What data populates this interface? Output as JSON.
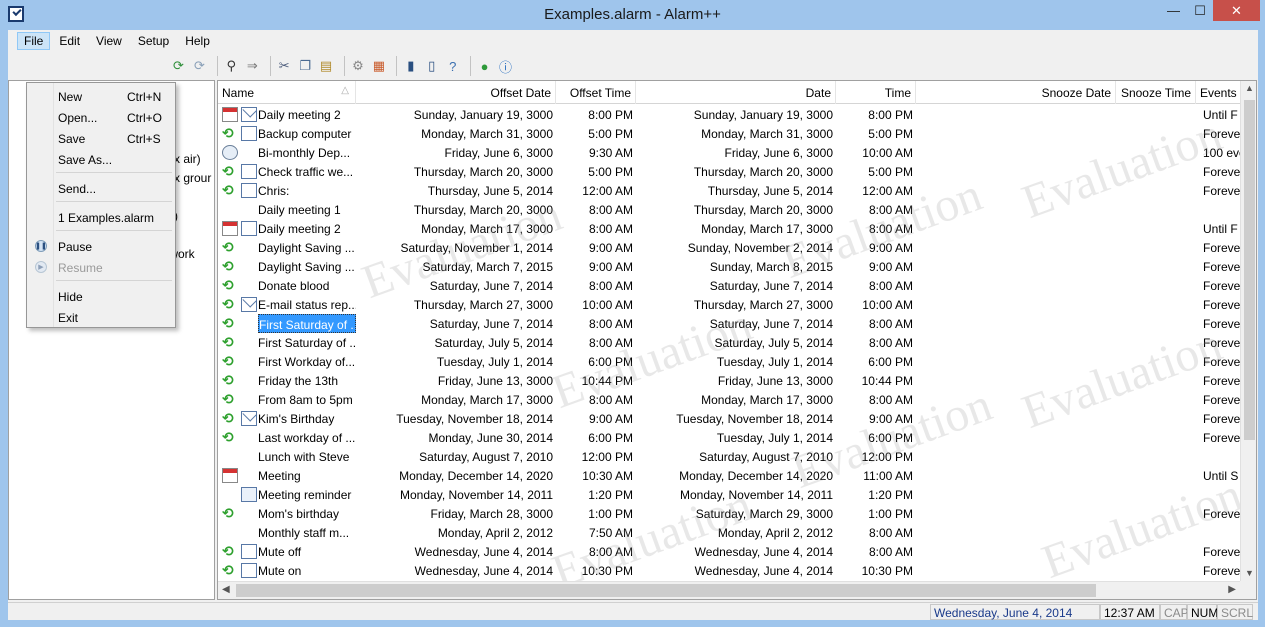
{
  "window": {
    "title": "Examples.alarm - Alarm++",
    "minimize": "—",
    "maximize": "☐",
    "close": "✕"
  },
  "menubar": [
    "File",
    "Edit",
    "View",
    "Setup",
    "Help"
  ],
  "toolbar_icons": [
    "open-folder-icon",
    "refresh-icon",
    "binoculars-icon",
    "arrow-icon",
    "cut-icon",
    "copy-icon",
    "paste-icon",
    "gear-icon",
    "calendar-icon",
    "book-icon",
    "open-book-icon",
    "help-icon",
    "globe-icon",
    "info-icon"
  ],
  "file_menu": {
    "items": [
      {
        "label": "New",
        "shortcut": "Ctrl+N"
      },
      {
        "label": "Open...",
        "shortcut": "Ctrl+O"
      },
      {
        "label": "Save",
        "shortcut": "Ctrl+S"
      },
      {
        "label": "Save As...",
        "shortcut": ""
      },
      {
        "label": "Send...",
        "shortcut": ""
      },
      {
        "label": "1 Examples.alarm",
        "shortcut": ""
      },
      {
        "label": "Pause",
        "shortcut": ""
      },
      {
        "label": "Resume",
        "shortcut": ""
      },
      {
        "label": "Hide",
        "shortcut": ""
      },
      {
        "label": "Exit",
        "shortcut": ""
      }
    ]
  },
  "tree_fragments": [
    "Ex air)",
    "Ex grour",
    ")",
    "S)",
    "twork"
  ],
  "columns": [
    "Name",
    "Offset Date",
    "Offset Time",
    "Date",
    "Time",
    "Snooze Date",
    "Snooze Time",
    "Events"
  ],
  "rows": [
    {
      "icon": "calendar",
      "icon2": "mail",
      "name": "Daily meeting 2",
      "odate": "Sunday, January 19, 3000",
      "otime": "8:00 PM",
      "date": "Sunday, January 19, 3000",
      "time": "8:00 PM",
      "events": "Until F"
    },
    {
      "icon": "recur",
      "icon2": "box",
      "name": "Backup computer",
      "odate": "Monday, March 31, 3000",
      "otime": "5:00 PM",
      "date": "Monday, March 31, 3000",
      "time": "5:00 PM",
      "events": "Foreve"
    },
    {
      "icon": "clock",
      "icon2": "",
      "name": "Bi-monthly Dep...",
      "odate": "Friday, June 6, 3000",
      "otime": "9:30 AM",
      "date": "Friday, June 6, 3000",
      "time": "10:00 AM",
      "events": "100 eve"
    },
    {
      "icon": "recur",
      "icon2": "box",
      "name": "Check traffic we...",
      "odate": "Thursday, March 20, 3000",
      "otime": "5:00 PM",
      "date": "Thursday, March 20, 3000",
      "time": "5:00 PM",
      "events": "Foreve"
    },
    {
      "icon": "recur",
      "icon2": "box",
      "name": "Chris:",
      "odate": "Thursday, June 5, 2014",
      "otime": "12:00 AM",
      "date": "Thursday, June 5, 2014",
      "time": "12:00 AM",
      "events": "Foreve"
    },
    {
      "icon": "",
      "icon2": "",
      "name": "Daily meeting 1",
      "odate": "Thursday, March 20, 3000",
      "otime": "8:00 AM",
      "date": "Thursday, March 20, 3000",
      "time": "8:00 AM",
      "events": ""
    },
    {
      "icon": "calendar",
      "icon2": "box",
      "name": "Daily meeting 2",
      "odate": "Monday, March 17, 3000",
      "otime": "8:00 AM",
      "date": "Monday, March 17, 3000",
      "time": "8:00 AM",
      "events": "Until F"
    },
    {
      "icon": "recur",
      "icon2": "",
      "name": "Daylight Saving ...",
      "odate": "Saturday, November 1, 2014",
      "otime": "9:00 AM",
      "date": "Sunday, November 2, 2014",
      "time": "9:00 AM",
      "events": "Foreve"
    },
    {
      "icon": "recur",
      "icon2": "",
      "name": "Daylight Saving ...",
      "odate": "Saturday, March 7, 2015",
      "otime": "9:00 AM",
      "date": "Sunday, March 8, 2015",
      "time": "9:00 AM",
      "events": "Foreve"
    },
    {
      "icon": "recur",
      "icon2": "",
      "name": "Donate blood",
      "odate": "Saturday, June 7, 2014",
      "otime": "8:00 AM",
      "date": "Saturday, June 7, 2014",
      "time": "8:00 AM",
      "events": "Foreve"
    },
    {
      "icon": "recur",
      "icon2": "mail",
      "name": "E-mail status rep...",
      "odate": "Thursday, March 27, 3000",
      "otime": "10:00 AM",
      "date": "Thursday, March 27, 3000",
      "time": "10:00 AM",
      "events": "Foreve"
    },
    {
      "icon": "recur",
      "icon2": "",
      "name": "First Saturday of ...",
      "odate": "Saturday, June 7, 2014",
      "otime": "8:00 AM",
      "date": "Saturday, June 7, 2014",
      "time": "8:00 AM",
      "events": "Foreve",
      "selected": true
    },
    {
      "icon": "recur",
      "icon2": "",
      "name": "First Saturday of ...",
      "odate": "Saturday, July 5, 2014",
      "otime": "8:00 AM",
      "date": "Saturday, July 5, 2014",
      "time": "8:00 AM",
      "events": "Foreve"
    },
    {
      "icon": "recur",
      "icon2": "",
      "name": "First Workday of...",
      "odate": "Tuesday, July 1, 2014",
      "otime": "6:00 PM",
      "date": "Tuesday, July 1, 2014",
      "time": "6:00 PM",
      "events": "Foreve"
    },
    {
      "icon": "recur",
      "icon2": "",
      "name": "Friday the 13th",
      "odate": "Friday, June 13, 3000",
      "otime": "10:44 PM",
      "date": "Friday, June 13, 3000",
      "time": "10:44 PM",
      "events": "Foreve"
    },
    {
      "icon": "recur",
      "icon2": "",
      "name": "From 8am to 5pm",
      "odate": "Monday, March 17, 3000",
      "otime": "8:00 AM",
      "date": "Monday, March 17, 3000",
      "time": "8:00 AM",
      "events": "Foreve"
    },
    {
      "icon": "recur",
      "icon2": "mail",
      "name": "Kim's Birthday",
      "odate": "Tuesday, November 18, 2014",
      "otime": "9:00 AM",
      "date": "Tuesday, November 18, 2014",
      "time": "9:00 AM",
      "events": "Foreve"
    },
    {
      "icon": "recur",
      "icon2": "",
      "name": "Last workday of ...",
      "odate": "Monday, June 30, 2014",
      "otime": "6:00 PM",
      "date": "Tuesday, July 1, 2014",
      "time": "6:00 PM",
      "events": "Foreve"
    },
    {
      "icon": "",
      "icon2": "",
      "name": "Lunch with Steve",
      "odate": "Saturday, August 7, 2010",
      "otime": "12:00 PM",
      "date": "Saturday, August 7, 2010",
      "time": "12:00 PM",
      "events": ""
    },
    {
      "icon": "calendar",
      "icon2": "",
      "name": "Meeting",
      "odate": "Monday, December 14, 2020",
      "otime": "10:30 AM",
      "date": "Monday, December 14, 2020",
      "time": "11:00 AM",
      "events": "Until S"
    },
    {
      "icon": "",
      "icon2": "memo",
      "name": "Meeting reminder",
      "odate": "Monday, November 14, 2011",
      "otime": "1:20 PM",
      "date": "Monday, November 14, 2011",
      "time": "1:20 PM",
      "events": ""
    },
    {
      "icon": "recur",
      "icon2": "",
      "name": "Mom's birthday",
      "odate": "Friday, March 28, 3000",
      "otime": "1:00 PM",
      "date": "Saturday, March 29, 3000",
      "time": "1:00 PM",
      "events": "Foreve"
    },
    {
      "icon": "",
      "icon2": "",
      "name": "Monthly staff m...",
      "odate": "Monday, April 2, 2012",
      "otime": "7:50 AM",
      "date": "Monday, April 2, 2012",
      "time": "8:00 AM",
      "events": ""
    },
    {
      "icon": "recur",
      "icon2": "box",
      "name": "Mute off",
      "odate": "Wednesday, June 4, 2014",
      "otime": "8:00 AM",
      "date": "Wednesday, June 4, 2014",
      "time": "8:00 AM",
      "events": "Foreve"
    },
    {
      "icon": "recur",
      "icon2": "box",
      "name": "Mute on",
      "odate": "Wednesday, June 4, 2014",
      "otime": "10:30 PM",
      "date": "Wednesday, June 4, 2014",
      "time": "10:30 PM",
      "events": "Foreve"
    }
  ],
  "watermark": "Evaluation",
  "statusbar": {
    "date": "Wednesday, June 4, 2014",
    "time": "12:37 AM",
    "cap": "CAP",
    "num": "NUM",
    "scrl": "SCRL"
  }
}
